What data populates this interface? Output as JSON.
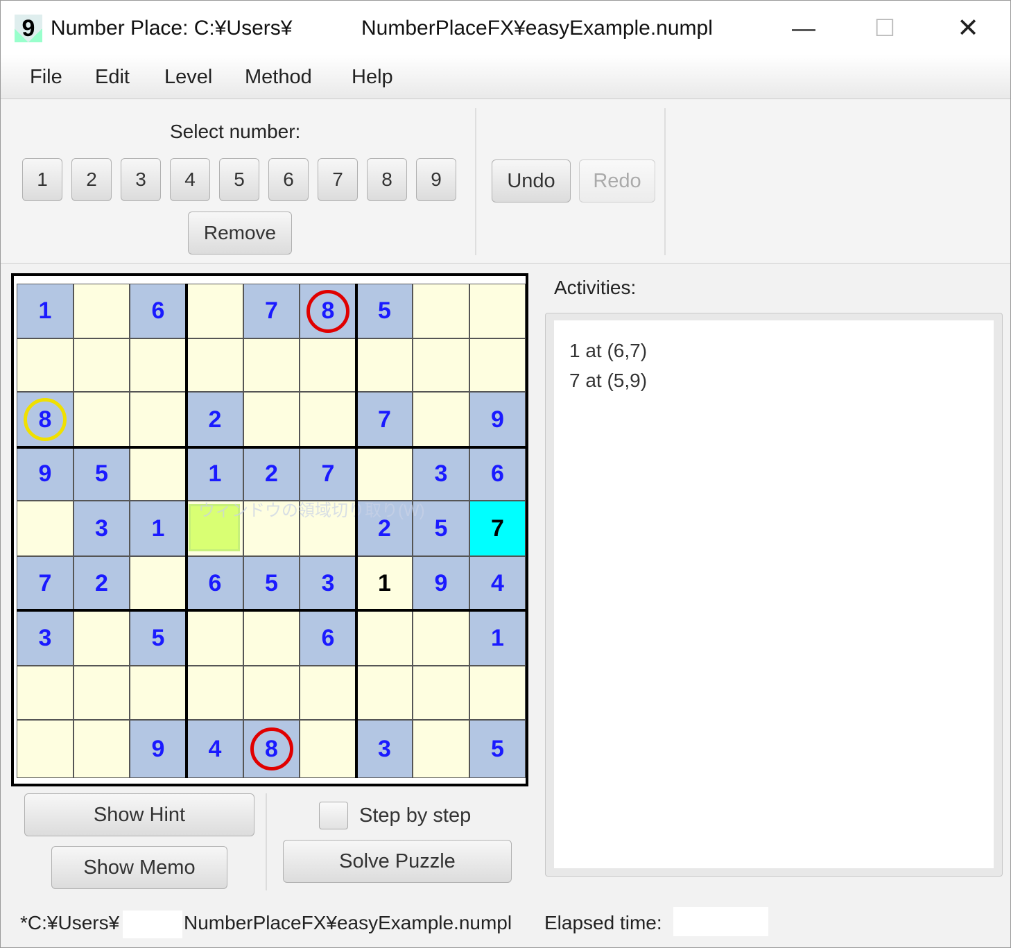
{
  "window": {
    "icon_glyph": "9",
    "title_part1": "Number Place: C:¥Users¥",
    "title_part2": "NumberPlaceFX¥easyExample.numpl",
    "minimize": "—",
    "maximize": "☐",
    "close": "✕"
  },
  "menu": [
    "File",
    "Edit",
    "Level",
    "Method",
    "Help"
  ],
  "toolbar": {
    "select_label": "Select number:",
    "numbers": [
      "1",
      "2",
      "3",
      "4",
      "5",
      "6",
      "7",
      "8",
      "9"
    ],
    "remove": "Remove",
    "undo": "Undo",
    "redo": "Redo"
  },
  "board": {
    "rows": [
      [
        "1",
        "",
        "6",
        "",
        "7",
        "8",
        "5",
        "",
        ""
      ],
      [
        "",
        "",
        "",
        "",
        "",
        "",
        "",
        "",
        ""
      ],
      [
        "8",
        "",
        "",
        "2",
        "",
        "",
        "7",
        "",
        "9"
      ],
      [
        "9",
        "5",
        "",
        "1",
        "2",
        "7",
        "",
        "3",
        "6"
      ],
      [
        "",
        "3",
        "1",
        "",
        "",
        "",
        "2",
        "5",
        "7"
      ],
      [
        "7",
        "2",
        "",
        "6",
        "5",
        "3",
        "1",
        "9",
        "4"
      ],
      [
        "3",
        "",
        "5",
        "",
        "",
        "6",
        "",
        "",
        "1"
      ],
      [
        "",
        "",
        "",
        "",
        "",
        "",
        "",
        "",
        ""
      ],
      [
        "",
        "",
        "9",
        "4",
        "8",
        "",
        "3",
        "",
        "5"
      ]
    ],
    "user_entries": [
      [
        4,
        8
      ],
      [
        5,
        6
      ]
    ],
    "selected_cell": [
      4,
      8
    ],
    "highlight_green_cell": [
      4,
      3
    ],
    "red_circles": [
      [
        0,
        5
      ],
      [
        8,
        4
      ]
    ],
    "yellow_circles": [
      [
        2,
        0
      ]
    ],
    "overlay_text": "ウィンドウの領域切り取り(W)",
    "colors": {
      "given_bg": "#b3c6e3",
      "empty_bg": "#fefee0",
      "selected_bg": "#00ffff",
      "digit_color": "#1a1aff"
    }
  },
  "controls": {
    "show_hint": "Show Hint",
    "show_memo": "Show Memo",
    "step_by_step": "Step by step",
    "solve_puzzle": "Solve Puzzle"
  },
  "activities": {
    "label": "Activities:",
    "items": [
      "1 at (6,7)",
      "7 at (5,9)"
    ]
  },
  "status": {
    "path_part1": "*C:¥Users¥",
    "path_part2": "NumberPlaceFX¥easyExample.numpl",
    "elapsed_label": "Elapsed time:"
  }
}
